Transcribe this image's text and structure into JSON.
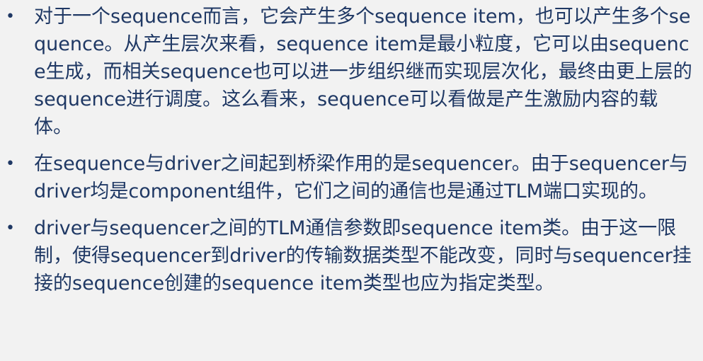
{
  "bullets": [
    {
      "marker": "•",
      "text": "对于一个sequence而言，它会产生多个sequence item，也可以产生多个sequence。从产生层次来看，sequence item是最小粒度，它可以由sequence生成，而相关sequence也可以进一步组织继而实现层次化，最终由更上层的sequence进行调度。这么看来，sequence可以看做是产生激励内容的载体。"
    },
    {
      "marker": "•",
      "text": "在sequence与driver之间起到桥梁作用的是sequencer。由于sequencer与driver均是component组件，它们之间的通信也是通过TLM端口实现的。"
    },
    {
      "marker": "•",
      "text": "driver与sequencer之间的TLM通信参数即sequence item类。由于这一限制，使得sequencer到driver的传输数据类型不能改变，同时与sequencer挂接的sequence创建的sequence item类型也应为指定类型。"
    }
  ],
  "colors": {
    "background": "#f2f2f2",
    "text": "#1f3864"
  }
}
